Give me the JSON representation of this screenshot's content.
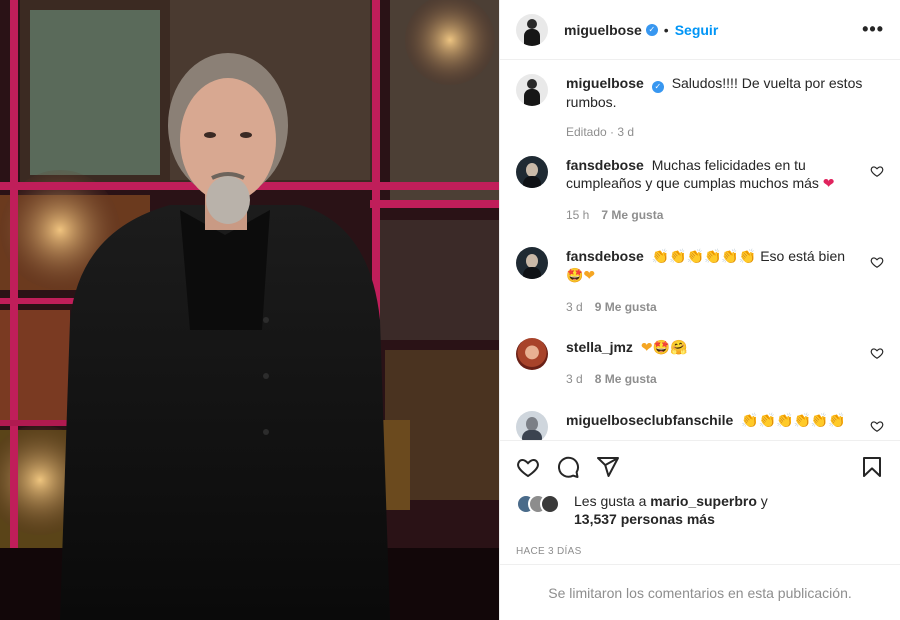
{
  "post": {
    "author": "miguelbose",
    "follow_label": "Seguir",
    "dot": "•",
    "more_label": "•••"
  },
  "caption": {
    "username": "miguelbose",
    "text": "Saludos!!!! De vuelta por estos rumbos.",
    "edited": "Editado · 3 d"
  },
  "comments": [
    {
      "username": "fansdebose",
      "text": "Muchas felicidades en tu cumpleaños y que cumplas muchos más",
      "emoji": "❤",
      "time": "15 h",
      "likes": "7 Me gusta"
    },
    {
      "username": "fansdebose",
      "emoji_lead": "👏👏👏👏👏👏",
      "text": "Eso está bien",
      "emoji": "🤩❤",
      "time": "3 d",
      "likes": "9 Me gusta"
    },
    {
      "username": "stella_jmz",
      "emoji": "❤🤩🤗",
      "time": "3 d",
      "likes": "8 Me gusta"
    },
    {
      "username": "miguelboseclubfanschile",
      "emoji": "👏👏👏👏👏👏"
    }
  ],
  "likes": {
    "prefix": "Les gusta a",
    "user": "mario_superbro",
    "connector": "y",
    "others": "13,537 personas más"
  },
  "timestamp": "HACE 3 DÍAS",
  "comments_limited": "Se limitaron los comentarios en esta publicación.",
  "icons": {
    "like": "heart-icon",
    "comment": "comment-icon",
    "share": "share-icon",
    "save": "bookmark-icon",
    "verified": "verified-badge-icon",
    "more": "more-options-icon"
  },
  "colors": {
    "accent": "#0095f6",
    "verified": "#3897f0",
    "muted": "#8e8e8e",
    "heart": "#e0245e"
  }
}
